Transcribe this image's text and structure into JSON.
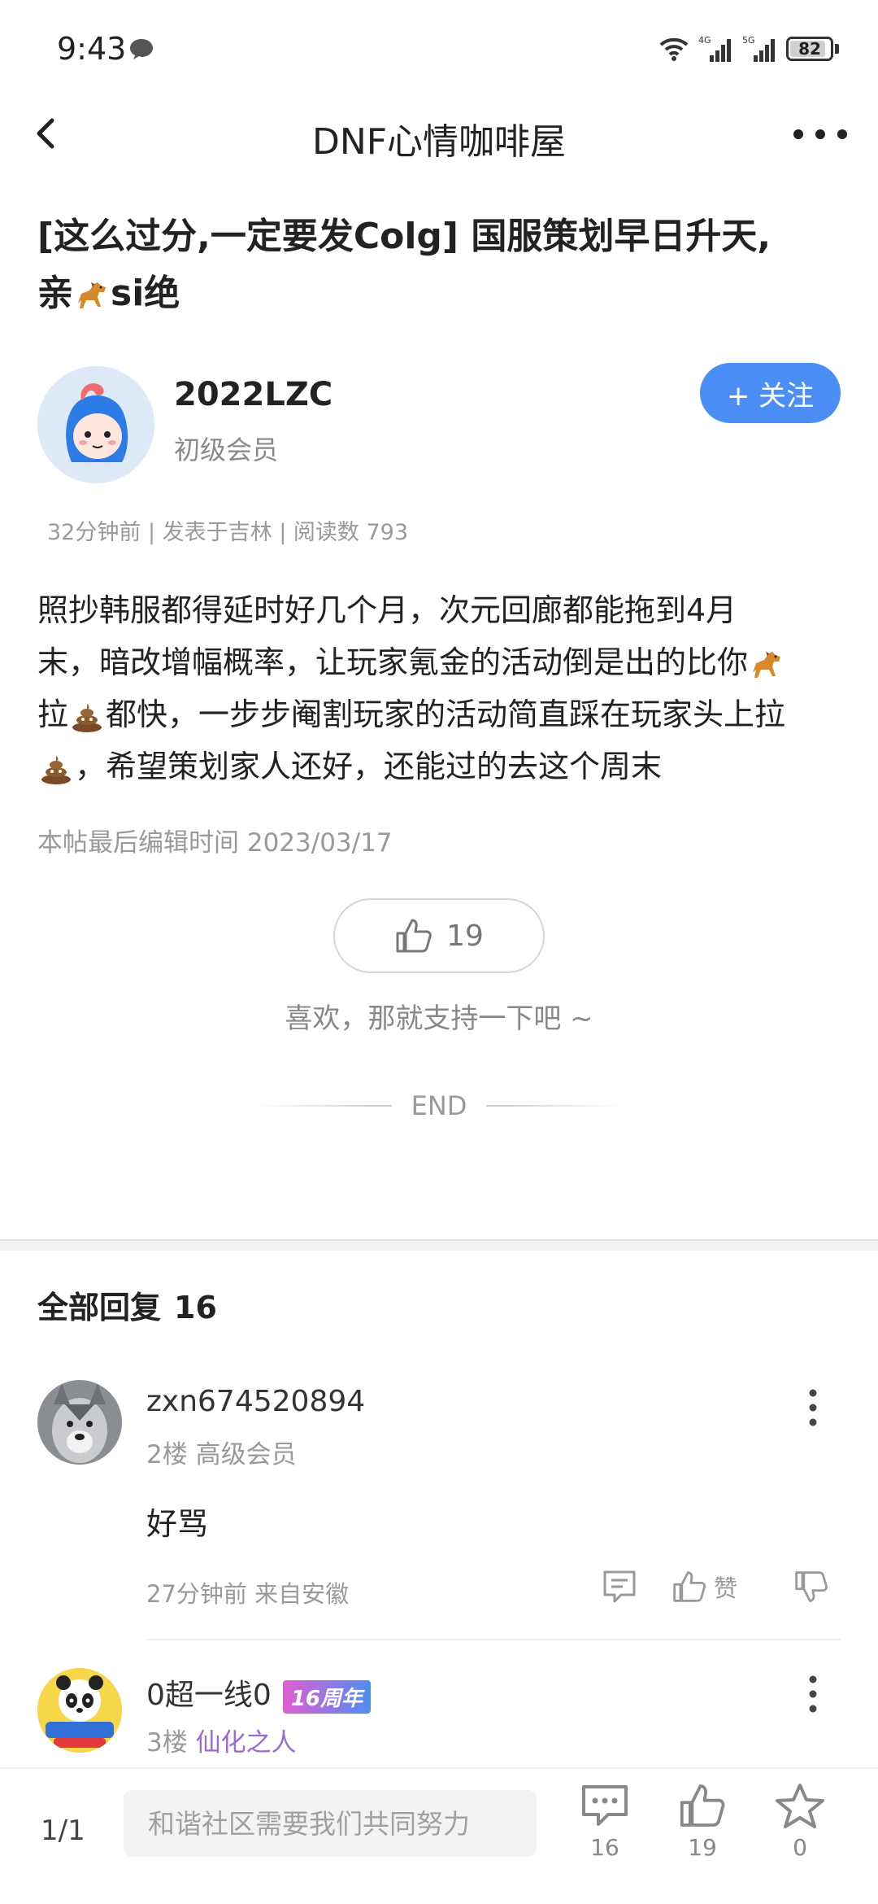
{
  "status_bar": {
    "time": "9:43",
    "battery": "82",
    "battery_level": 0.82,
    "network_labels": [
      "4G",
      "5G"
    ]
  },
  "nav": {
    "title": "DNF心情咖啡屋",
    "back_icon": "chevron-left-icon",
    "more_icon": "more-dots-icon"
  },
  "post": {
    "title_line1": "[这么过分,一定要发Colg] 国服策划早日升天,",
    "title_line2_a": "亲",
    "title_line2_b": "si绝",
    "author": {
      "name": "2022LZC",
      "level": "初级会员",
      "follow_label": "+ 关注"
    },
    "meta": "32分钟前 | 发表于吉林 | 阅读数 793",
    "body": {
      "l1": "照抄韩服都得延时好几个月，次元回廊都能拖到4月",
      "l2": "末，暗改增幅概率，让玩家氪金的活动倒是出的比你",
      "l3a": "拉",
      "l3b": "都快，一步步阉割玩家的活动简直踩在玩家头上拉",
      "l4": "，希望策划家人还好，还能过的去这个周末"
    },
    "edited": "本帖最后编辑时间 2023/03/17",
    "likes": "19",
    "like_hint": "喜欢，那就支持一下吧 ~",
    "end_label": "END"
  },
  "replies": {
    "header": "全部回复",
    "count": "16",
    "items": [
      {
        "name": "zxn674520894",
        "floor": "2楼 高级会员",
        "text": "好骂",
        "time": "27分钟前 来自安徽",
        "like_label": "赞"
      },
      {
        "name": "0超一线0",
        "badge": "16周年",
        "floor": "3楼",
        "rank": "仙化之人"
      }
    ]
  },
  "bottom_bar": {
    "page": "1/1",
    "input_placeholder": "和谐社区需要我们共同努力",
    "comments": "16",
    "likes": "19",
    "favorites": "0"
  },
  "colors": {
    "accent": "#4b8ef5",
    "rank_purple": "#9a6bd6"
  }
}
